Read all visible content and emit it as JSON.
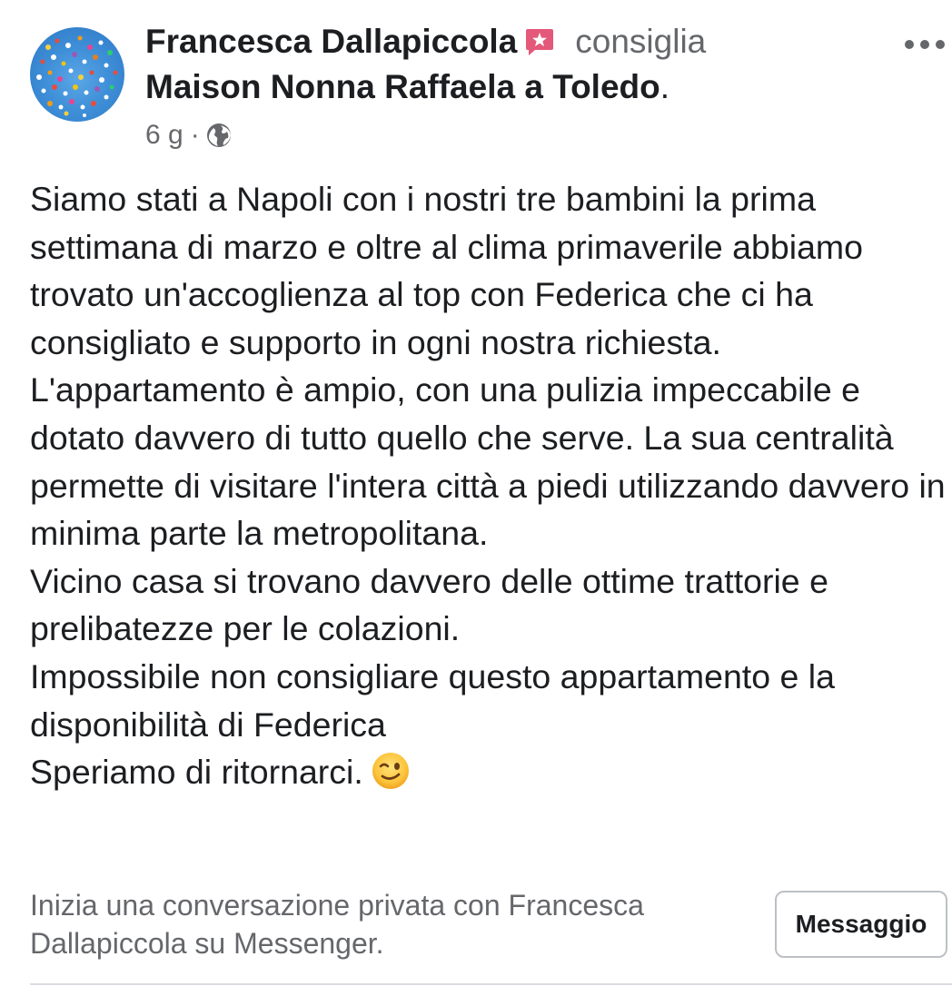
{
  "post": {
    "author_name": "Francesca Dallapiccola",
    "recommend_icon": "recommendation-star-icon",
    "action_text": "consiglia",
    "page_name": "Maison Nonna Raffaela a Toledo",
    "page_name_suffix": ".",
    "time_ago": "6 g",
    "separator": "·",
    "privacy_icon": "globe-icon",
    "more_icon": "more-options-icon",
    "accent_color": "#e4587a",
    "body_lines": [
      "Siamo stati a Napoli con i nostri tre bambini la prima settimana di marzo e oltre al clima primaverile abbiamo trovato un'accoglienza al top con Federica che ci ha consigliato e supporto in ogni nostra richiesta.",
      "L'appartamento è ampio, con una pulizia impeccabile e dotato davvero di tutto quello che serve. La sua centralità permette di visitare l'intera città a piedi utilizzando davvero in minima parte la metropolitana.",
      "Vicino casa si trovano davvero delle ottime trattorie e prelibatezze per le colazioni.",
      "Impossibile non consigliare questo appartamento e la disponibilità di Federica",
      "Speriamo di ritornarci."
    ],
    "closing_emoji": "winking-face-emoji"
  },
  "footer": {
    "prompt_text": "Inizia una conversazione privata con Francesca Dallapiccola su Messenger.",
    "message_button_label": "Messaggio"
  }
}
